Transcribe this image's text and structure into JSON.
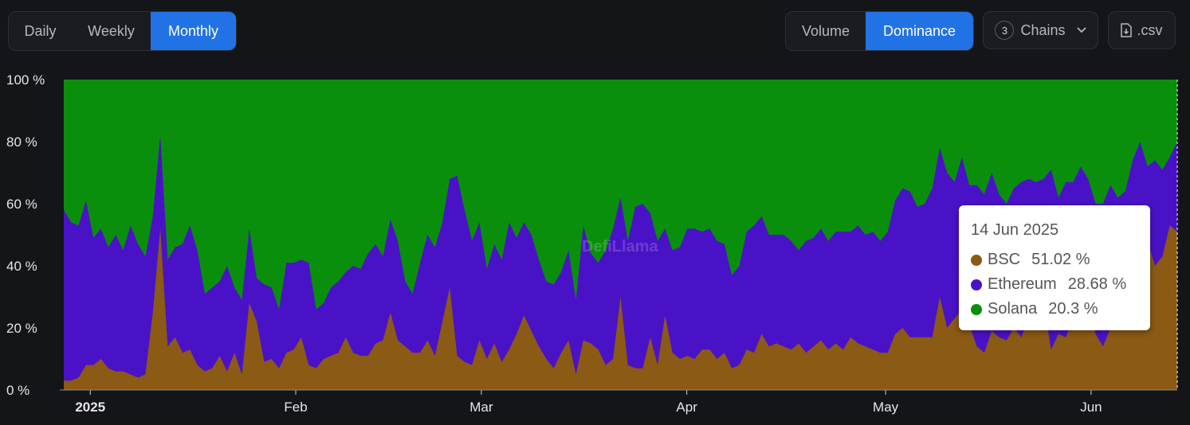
{
  "controls": {
    "range_tabs": [
      {
        "label": "Daily",
        "active": false
      },
      {
        "label": "Weekly",
        "active": false
      },
      {
        "label": "Monthly",
        "active": true
      }
    ],
    "metric_tabs": [
      {
        "label": "Volume",
        "active": false
      },
      {
        "label": "Dominance",
        "active": true
      }
    ],
    "chains_count": "3",
    "chains_label": "Chains",
    "csv_label": ".csv",
    "accent_color": "#2172e5"
  },
  "watermark": "DefiLlama",
  "tooltip": {
    "date": "14 Jun 2025",
    "rows": [
      {
        "name": "BSC",
        "value": "51.02 %",
        "color": "#8b5a14"
      },
      {
        "name": "Ethereum",
        "value": "28.68 %",
        "color": "#4a12c6"
      },
      {
        "name": "Solana",
        "value": "20.3 %",
        "color": "#0a8f0d"
      }
    ]
  },
  "chart_data": {
    "type": "area",
    "stacked": true,
    "normalized": true,
    "x_ticks": [
      "2025",
      "Feb",
      "Mar",
      "Apr",
      "May",
      "Jun"
    ],
    "y_ticks": [
      "0 %",
      "20 %",
      "40 %",
      "60 %",
      "80 %",
      "100 %"
    ],
    "ylim": [
      0,
      100
    ],
    "x_range": [
      "2024-12-28",
      "2025-06-14"
    ],
    "legend": "tooltip",
    "series": [
      {
        "name": "BSC",
        "color": "#8b5a14",
        "values": [
          3,
          3,
          4,
          8,
          8,
          10,
          7,
          6,
          6,
          5,
          4,
          5,
          25,
          52,
          14,
          17,
          12,
          13,
          8,
          6,
          7,
          11,
          6,
          12,
          5,
          28,
          22,
          9,
          10,
          7,
          12,
          13,
          17,
          8,
          7,
          10,
          11,
          12,
          17,
          12,
          11,
          11,
          15,
          16,
          25,
          16,
          14,
          12,
          12,
          16,
          11,
          22,
          33,
          11,
          9,
          8,
          16,
          10,
          15,
          9,
          13,
          18,
          24,
          19,
          14,
          10,
          7,
          12,
          16,
          5,
          16,
          15,
          13,
          8,
          10,
          30,
          8,
          7,
          7,
          17,
          8,
          24,
          12,
          10,
          11,
          10,
          13,
          13,
          10,
          12,
          7,
          8,
          13,
          12,
          18,
          14,
          15,
          14,
          13,
          15,
          12,
          14,
          16,
          13,
          15,
          13,
          17,
          15,
          14,
          13,
          12,
          12,
          18,
          20,
          17,
          17,
          17,
          17,
          30,
          20,
          23,
          26,
          21,
          14,
          12,
          19,
          17,
          16,
          20,
          17,
          23,
          20,
          28,
          13,
          18,
          17,
          23,
          25,
          27,
          18,
          14,
          20,
          20,
          30,
          38,
          60,
          48,
          40,
          43,
          53,
          51
        ]
      },
      {
        "name": "Ethereum",
        "color": "#4a12c6",
        "values": [
          55,
          51,
          49,
          53,
          41,
          42,
          39,
          44,
          39,
          48,
          43,
          38,
          31,
          30,
          28,
          29,
          35,
          40,
          37,
          25,
          26,
          24,
          34,
          21,
          24,
          24,
          14,
          25,
          23,
          19,
          29,
          28,
          25,
          33,
          19,
          18,
          22,
          23,
          21,
          28,
          28,
          33,
          32,
          27,
          30,
          32,
          21,
          19,
          29,
          34,
          35,
          32,
          35,
          58,
          49,
          40,
          38,
          29,
          32,
          33,
          41,
          31,
          30,
          31,
          28,
          25,
          27,
          26,
          29,
          24,
          37,
          29,
          28,
          37,
          42,
          32,
          40,
          52,
          53,
          40,
          40,
          28,
          33,
          36,
          41,
          42,
          38,
          39,
          38,
          35,
          30,
          32,
          38,
          41,
          38,
          36,
          35,
          36,
          35,
          30,
          36,
          35,
          36,
          35,
          36,
          38,
          34,
          38,
          36,
          38,
          36,
          39,
          43,
          45,
          47,
          42,
          43,
          48,
          48,
          50,
          44,
          49,
          45,
          52,
          51,
          51,
          46,
          44,
          45,
          50,
          45,
          47,
          40,
          58,
          44,
          50,
          44,
          47,
          41,
          42,
          46,
          46,
          42,
          34,
          36,
          20,
          24,
          34,
          28,
          22,
          29
        ]
      }
    ]
  }
}
